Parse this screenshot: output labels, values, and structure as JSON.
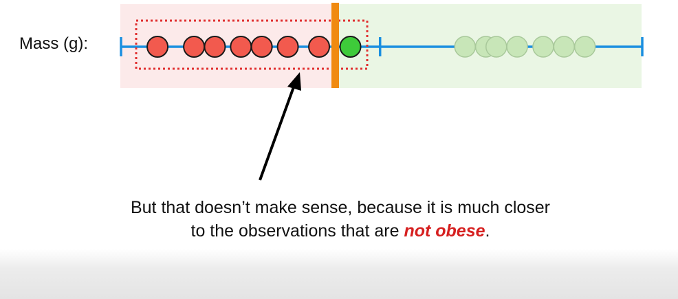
{
  "axis_label": "Mass (g):",
  "caption": {
    "line1": "But that doesn’t make sense, because it is much closer",
    "line2_prefix": "to the observations that are ",
    "line2_emphasis": "not obese",
    "line2_suffix": "."
  },
  "colors": {
    "axis": "#1a8fe0",
    "threshold": "#f08a10",
    "obese_point": "#f25a4e",
    "misclassified_point": "#3ecb3a",
    "not_obese_point": "#c8e6b8",
    "red_region": "#fceaea",
    "green_region": "#eaf6e4",
    "dotted_box": "#e03030",
    "caption_emphasis": "#d62020"
  },
  "chart_data": {
    "type": "scatter",
    "axis_variable": "Mass (g)",
    "axis_ticks_at": [
      "start",
      "threshold-right",
      "end"
    ],
    "threshold_position": 0.43,
    "observations": [
      {
        "value": 0.07,
        "group": "obese"
      },
      {
        "value": 0.14,
        "group": "obese"
      },
      {
        "value": 0.18,
        "group": "obese"
      },
      {
        "value": 0.23,
        "group": "obese"
      },
      {
        "value": 0.27,
        "group": "obese"
      },
      {
        "value": 0.32,
        "group": "obese"
      },
      {
        "value": 0.38,
        "group": "obese"
      },
      {
        "value": 0.44,
        "group": "misclassified"
      },
      {
        "value": 0.66,
        "group": "not-obese"
      },
      {
        "value": 0.7,
        "group": "not-obese"
      },
      {
        "value": 0.72,
        "group": "not-obese"
      },
      {
        "value": 0.76,
        "group": "not-obese"
      },
      {
        "value": 0.81,
        "group": "not-obese"
      },
      {
        "value": 0.85,
        "group": "not-obese"
      },
      {
        "value": 0.89,
        "group": "not-obese"
      }
    ],
    "highlight": "dotted box around obese-classified observations",
    "arrow": "points from caption to highlighted group"
  }
}
